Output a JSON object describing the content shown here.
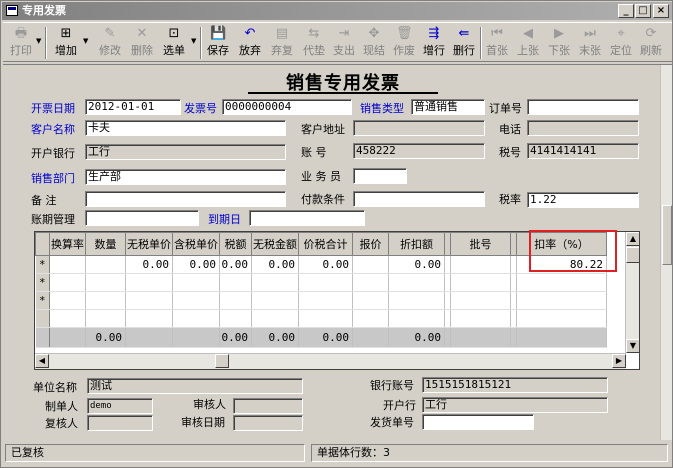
{
  "window": {
    "title": "专用发票",
    "min": "_",
    "max": "□",
    "close": "×"
  },
  "toolbar": {
    "print": "打印",
    "add": "增加",
    "edit": "修改",
    "delete": "删除",
    "select": "选单",
    "save": "保存",
    "abandon": "放弃",
    "recheck": "弃复",
    "substitute": "代垫",
    "expense": "支出",
    "settle": "现结",
    "void": "作废",
    "addrow": "增行",
    "delrow": "删行",
    "first": "首张",
    "prev": "上张",
    "next": "下张",
    "last": "末张",
    "locate": "定位",
    "refresh": "刷新"
  },
  "form": {
    "title": "销售专用发票",
    "invoice_date_label": "开票日期",
    "invoice_date": "2012-01-01",
    "invoice_no_label": "发票号",
    "invoice_no": "0000000004",
    "sale_type_label": "销售类型",
    "sale_type": "普通销售",
    "order_no_label": "订单号",
    "order_no": "",
    "customer_label": "客户名称",
    "customer": "卡夫",
    "customer_addr_label": "客户地址",
    "customer_addr": "",
    "phone_label": "电话",
    "phone": "",
    "bank_label": "开户银行",
    "bank": "工行",
    "account_label": "账    号",
    "account": "458222",
    "tax_no_label": "税号",
    "tax_no": "4141414141",
    "dept_label": "销售部门",
    "dept": "生产部",
    "salesman_label": "业 务 员",
    "salesman": "",
    "remark_label": "备    注",
    "remark": "",
    "payment_label": "付款条件",
    "payment": "",
    "tax_rate_label": "税率",
    "tax_rate": "1.22",
    "aging_label": "账期管理",
    "aging": "",
    "due_label": "到期日",
    "due": ""
  },
  "grid": {
    "headers": [
      "换算率",
      "数量",
      "无税单价",
      "含税单价",
      "税额",
      "无税金额",
      "价税合计",
      "报价",
      "折扣额",
      "",
      "批号",
      "",
      "扣率（%）"
    ],
    "rows": [
      {
        "mark": "*",
        "cells": [
          "",
          "",
          "0.00",
          "0.00",
          "0.00",
          "0.00",
          "0.00",
          "",
          "0.00",
          "",
          "",
          "",
          "80.22"
        ]
      },
      {
        "mark": "*",
        "cells": [
          "",
          "",
          "",
          "",
          "",
          "",
          "",
          "",
          "",
          "",
          "",
          "",
          ""
        ]
      },
      {
        "mark": "*",
        "cells": [
          "",
          "",
          "",
          "",
          "",
          "",
          "",
          "",
          "",
          "",
          "",
          "",
          ""
        ]
      },
      {
        "mark": "",
        "cells": [
          "",
          "",
          "",
          "",
          "",
          "",
          "",
          "",
          "",
          "",
          "",
          "",
          ""
        ]
      }
    ],
    "sum": [
      "",
      "0.00",
      "",
      "",
      "0.00",
      "0.00",
      "0.00",
      "",
      "0.00",
      "",
      "",
      "",
      ""
    ]
  },
  "footer": {
    "unit_label": "单位名称",
    "unit": "测试",
    "bank_account_label": "银行账号",
    "bank_account": "1515151815121",
    "maker_label": "制单人",
    "maker": "demo",
    "auditor_label": "审核人",
    "auditor": "",
    "bank2_label": "开户行",
    "bank2": "工行",
    "rechecker_label": "复核人",
    "rechecker": "",
    "audit_date_label": "审核日期",
    "audit_date": "",
    "ship_no_label": "发货单号",
    "ship_no": ""
  },
  "status": {
    "state": "已复核",
    "rows": "单据体行数：3"
  }
}
